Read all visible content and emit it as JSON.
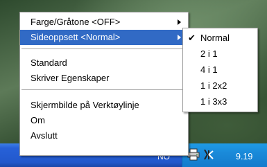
{
  "main_menu": {
    "items": [
      {
        "label": "Farge/Gråtone <OFF>",
        "has_submenu": true
      },
      {
        "label": "Sideoppsett <Normal>",
        "has_submenu": true,
        "selected": true
      },
      {
        "label": "Standard"
      },
      {
        "label": "Skriver Egenskaper"
      },
      {
        "label": "Skjermbilde på Verktøylinje"
      },
      {
        "label": "Om"
      },
      {
        "label": "Avslutt"
      }
    ]
  },
  "sub_menu": {
    "items": [
      {
        "label": "Normal",
        "checked": true
      },
      {
        "label": "2 i 1"
      },
      {
        "label": "4 i 1"
      },
      {
        "label": "1 i 2x2"
      },
      {
        "label": "1 i 3x3"
      }
    ]
  },
  "taskbar": {
    "partial_text": "NO",
    "clock": "9.19",
    "tray_icons": [
      "printer-icon",
      "network-icon"
    ]
  },
  "colors": {
    "selection": "#316ac5",
    "taskbar": "#2258cc",
    "tray": "#1a8ad9"
  }
}
